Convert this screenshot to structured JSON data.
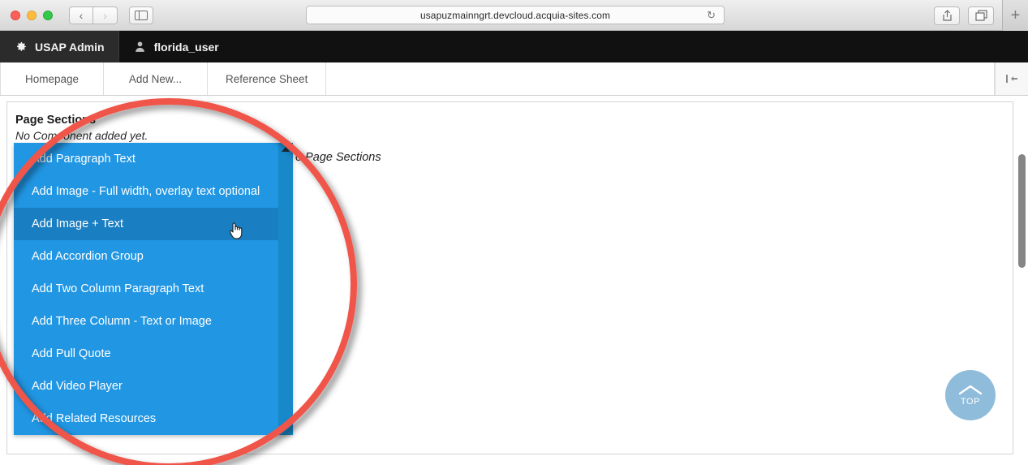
{
  "browser": {
    "url": "usapuzmainngrt.devcloud.acquia-sites.com",
    "back_label": "‹",
    "forward_label": "›",
    "reload_label": "↻",
    "newtab_label": "+",
    "traffic_lights": [
      "close",
      "minimize",
      "zoom"
    ],
    "icons": {
      "sidebar": "sidebar-toggle-icon",
      "share": "share-icon",
      "tabs": "tab-overview-icon",
      "reload": "reload-icon"
    }
  },
  "admin_bar": {
    "items": [
      {
        "label": "USAP Admin",
        "icon": "gear-icon"
      },
      {
        "label": "florida_user",
        "icon": "person-icon"
      }
    ]
  },
  "tab_nav": {
    "tabs": [
      {
        "label": "Homepage"
      },
      {
        "label": "Add New..."
      },
      {
        "label": "Reference Sheet"
      }
    ],
    "toolbar_toggle_icon": "collapse-toolbar-icon"
  },
  "content": {
    "section_title": "Page Sections",
    "empty_message": "No Component added yet.",
    "behind_label": "o Page Sections"
  },
  "dropdown": {
    "selected_index": 2,
    "items": [
      {
        "label": "Add Paragraph Text"
      },
      {
        "label": "Add Image - Full width, overlay text optional"
      },
      {
        "label": "Add Image + Text"
      },
      {
        "label": "Add Accordion Group"
      },
      {
        "label": "Add Two Column Paragraph Text"
      },
      {
        "label": "Add Three Column - Text or Image"
      },
      {
        "label": "Add Pull Quote"
      },
      {
        "label": "Add Video Player"
      },
      {
        "label": "Add Related Resources"
      }
    ]
  },
  "top_button": {
    "label": "TOP",
    "icon": "chevron-up-icon"
  },
  "colors": {
    "dropdown_item": "#2196e3",
    "dropdown_selected": "#1a7ec2",
    "dropdown_scrollbar": "#1888c9",
    "admin_bar": "#111111",
    "admin_bar_primary": "#2b2b2b",
    "annotation_circle": "#f0544a",
    "top_button": "#8fbcdb",
    "page_scrollbar": "#858585"
  }
}
